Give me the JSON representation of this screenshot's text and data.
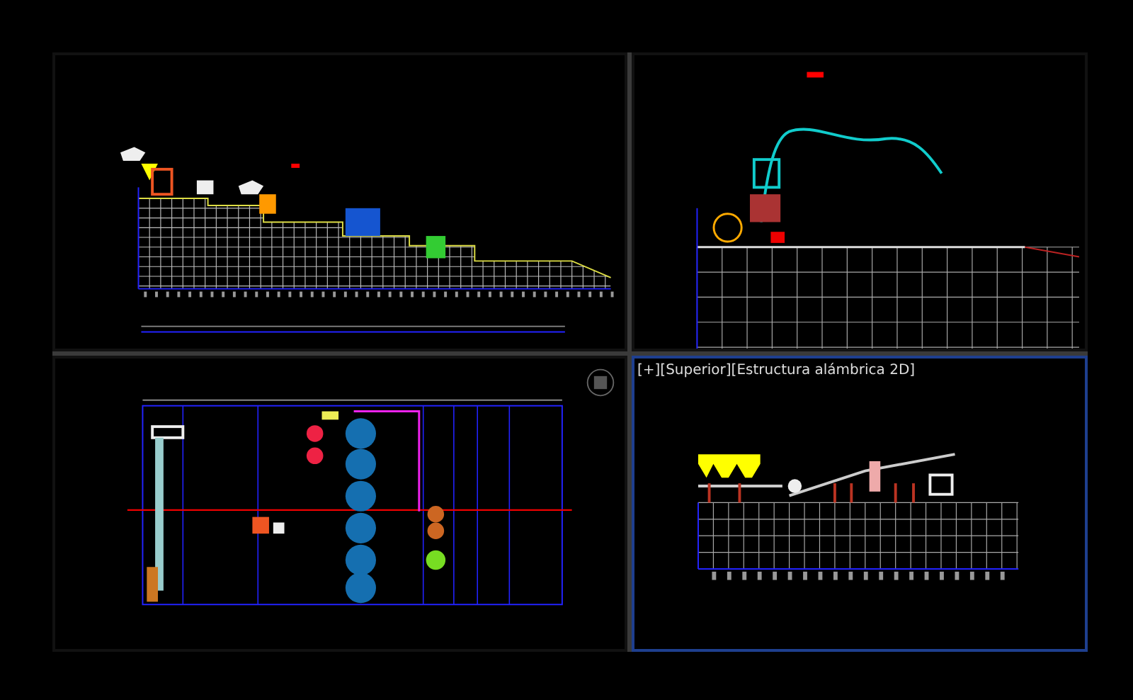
{
  "viewports": [
    {
      "kind": "elevation",
      "active": false
    },
    {
      "kind": "detail",
      "active": false
    },
    {
      "kind": "plan",
      "active": false
    },
    {
      "kind": "elevation",
      "active": true,
      "label": "[+][Superior][Estructura alámbrica 2D]"
    }
  ]
}
